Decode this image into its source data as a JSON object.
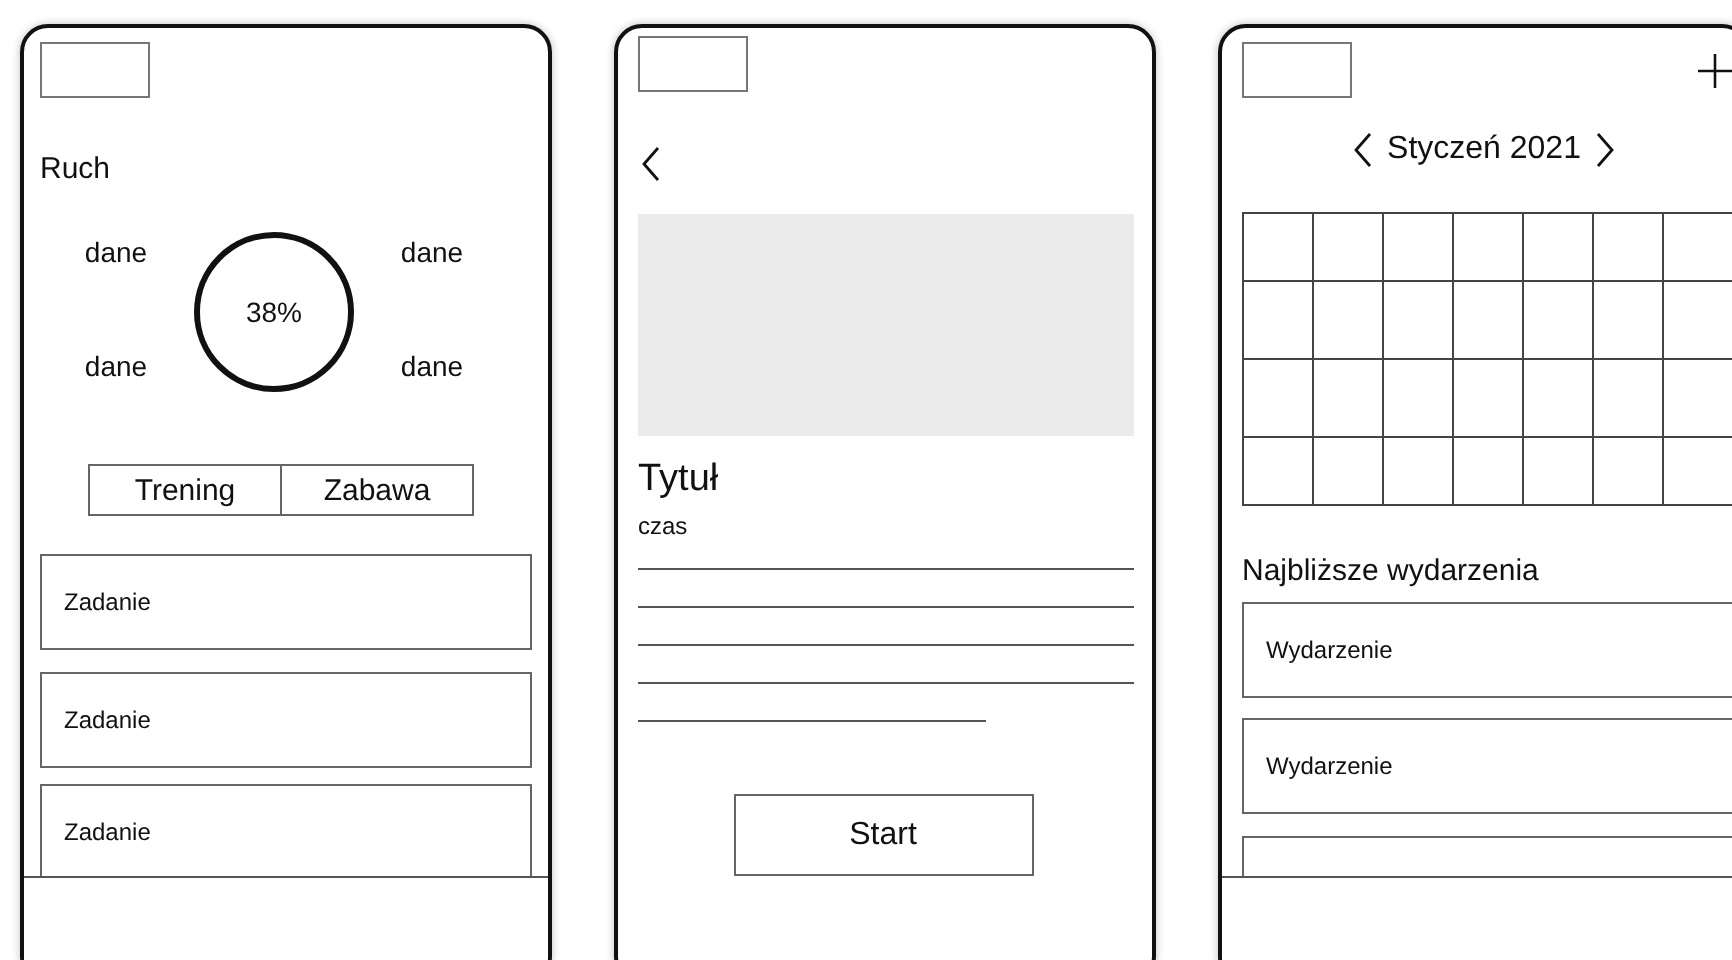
{
  "screens": [
    {
      "kind": "activity",
      "has_nav_bar": true,
      "title": "Ruch",
      "progress": "38%",
      "stats": [
        "dane",
        "dane",
        "dane",
        "dane"
      ],
      "segments": [
        "Trening",
        "Zabawa"
      ],
      "tasks": [
        "Zadanie",
        "Zadanie",
        "Zadanie"
      ]
    },
    {
      "kind": "detail",
      "has_nav_bar": false,
      "title": "Tytuł",
      "time": "czas",
      "button": "Start"
    },
    {
      "kind": "calendar",
      "has_nav_bar": true,
      "month": "Styczeń 2021",
      "section_title": "Najbliższe wydarzenia",
      "events": [
        "Wydarzenie",
        "Wydarzenie"
      ],
      "more_events_below": true
    }
  ]
}
